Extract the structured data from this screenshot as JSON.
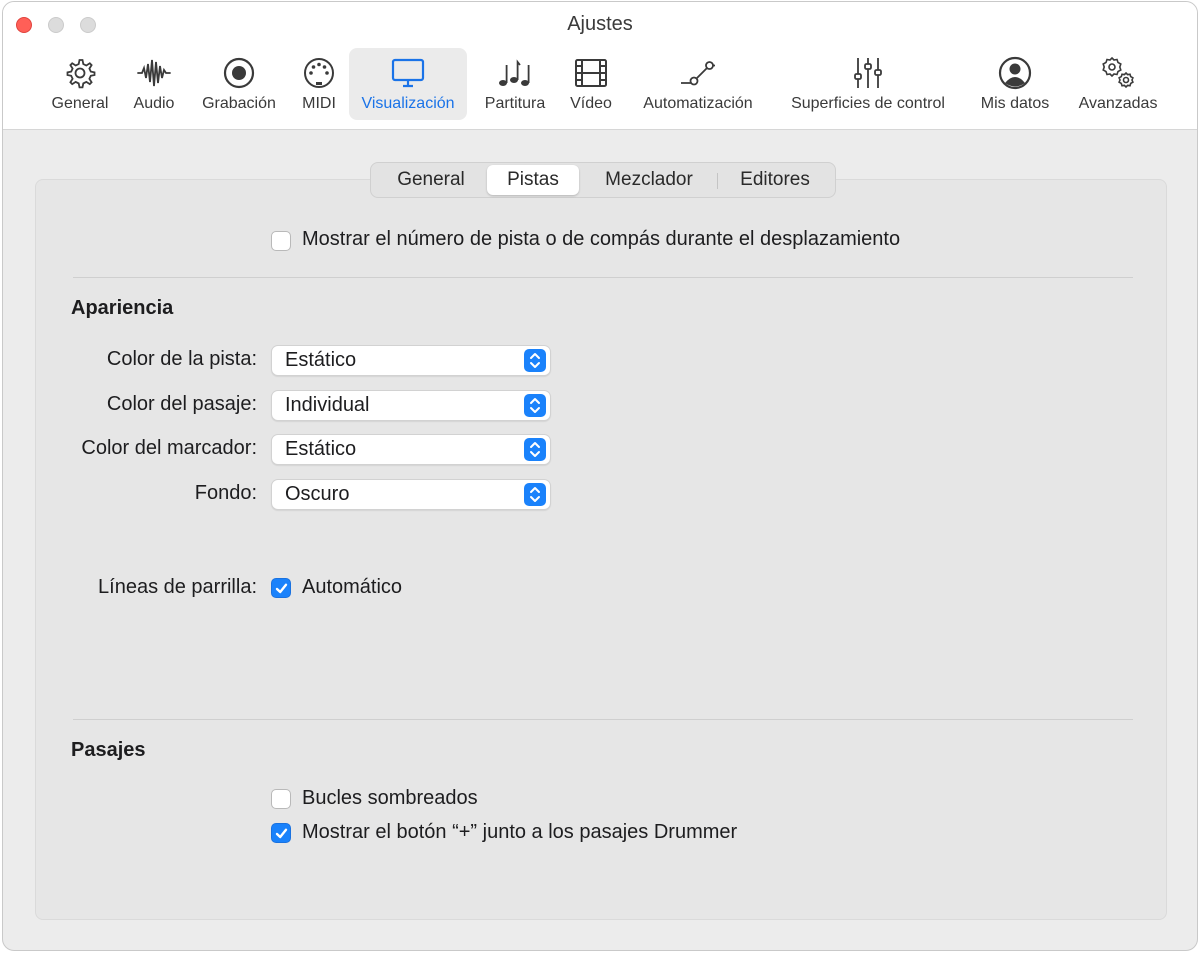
{
  "window": {
    "title": "Ajustes"
  },
  "toolbar": [
    {
      "label": "General",
      "icon": "gear-icon"
    },
    {
      "label": "Audio",
      "icon": "waveform-icon"
    },
    {
      "label": "Grabación",
      "icon": "record-icon"
    },
    {
      "label": "MIDI",
      "icon": "midi-port-icon"
    },
    {
      "label": "Visualización",
      "icon": "display-icon",
      "active": true
    },
    {
      "label": "Partitura",
      "icon": "music-notes-icon"
    },
    {
      "label": "Vídeo",
      "icon": "film-icon"
    },
    {
      "label": "Automatización",
      "icon": "automation-curve-icon"
    },
    {
      "label": "Superficies de control",
      "icon": "faders-icon"
    },
    {
      "label": "Mis datos",
      "icon": "person-circle-icon"
    },
    {
      "label": "Avanzadas",
      "icon": "gears-icon"
    }
  ],
  "tabs": [
    {
      "label": "General"
    },
    {
      "label": "Pistas",
      "selected": true
    },
    {
      "label": "Mezclador"
    },
    {
      "label": "Editores"
    }
  ],
  "top_option": {
    "label": "Mostrar el número de pista o de compás durante el desplazamiento",
    "checked": false
  },
  "appearance": {
    "title": "Apariencia",
    "rows": [
      {
        "label": "Color de la pista:",
        "value": "Estático"
      },
      {
        "label": "Color del pasaje:",
        "value": "Individual"
      },
      {
        "label": "Color del marcador:",
        "value": "Estático"
      },
      {
        "label": "Fondo:",
        "value": "Oscuro"
      }
    ],
    "grid_label": "Líneas de parrilla:",
    "grid_option": {
      "label": "Automático",
      "checked": true
    }
  },
  "regions": {
    "title": "Pasajes",
    "options": [
      {
        "label": "Bucles sombreados",
        "checked": false
      },
      {
        "label": "Mostrar el botón “+” junto a los pasajes Drummer",
        "checked": true
      }
    ]
  },
  "colors": {
    "accent": "#1a82fb",
    "close": "#ff5f57"
  }
}
